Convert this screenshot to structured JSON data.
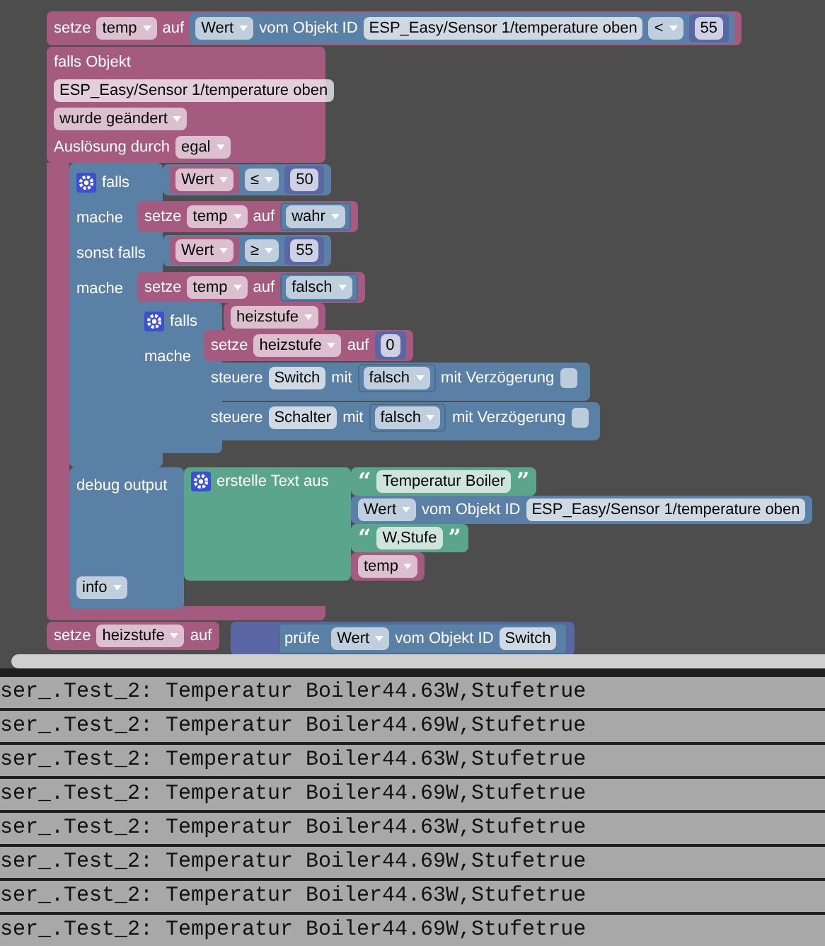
{
  "workspace": {
    "blocks": [
      {
        "kind": "variable",
        "lines": [
          [
            {
              "kind": "label",
              "text": "setze"
            },
            {
              "kind": "dropdown",
              "text": "temp"
            },
            {
              "kind": "label",
              "text": "auf"
            },
            {
              "kind": "sensor",
              "lines": [
                [
                  {
                    "kind": "dropdown",
                    "text": "Wert"
                  },
                  {
                    "kind": "label",
                    "text": "vom Objekt ID"
                  },
                  {
                    "kind": "field",
                    "text": "ESP_Easy/Sensor 1/temperature oben"
                  },
                  {
                    "kind": "dropdown",
                    "text": "<"
                  },
                  {
                    "kind": "math",
                    "lines": [
                      [
                        {
                          "kind": "number",
                          "text": "55"
                        }
                      ]
                    ]
                  }
                ]
              ]
            }
          ]
        ]
      },
      {
        "kind": "event",
        "lines": [
          [
            {
              "kind": "label",
              "text": "falls Objekt"
            }
          ],
          [
            {
              "kind": "field",
              "text": "ESP_Easy/Sensor 1/temperature oben"
            }
          ],
          [
            {
              "kind": "dropdown",
              "text": "wurde geändert"
            }
          ],
          [
            {
              "kind": "label",
              "text": "Auslösung durch"
            },
            {
              "kind": "dropdown",
              "text": "egal"
            }
          ]
        ]
      },
      {
        "kind": "control",
        "lines": [
          [
            {
              "kind": "gear"
            },
            {
              "kind": "label",
              "text": "falls"
            }
          ],
          [
            {
              "kind": "label",
              "text": "mache"
            }
          ],
          [
            {
              "kind": "label",
              "text": "sonst falls"
            }
          ],
          [
            {
              "kind": "label",
              "text": "mache"
            }
          ]
        ]
      },
      {
        "kind": "logic",
        "lines": [
          [
            {
              "kind": "variable",
              "lines": [
                [
                  {
                    "kind": "dropdown",
                    "text": "Wert"
                  }
                ]
              ]
            },
            {
              "kind": "dropdown",
              "text": "≤"
            },
            {
              "kind": "math",
              "lines": [
                [
                  {
                    "kind": "number",
                    "text": "50"
                  }
                ]
              ]
            }
          ]
        ]
      },
      {
        "kind": "variable",
        "lines": [
          [
            {
              "kind": "label",
              "text": "setze"
            },
            {
              "kind": "dropdown",
              "text": "temp"
            },
            {
              "kind": "label",
              "text": "auf"
            },
            {
              "kind": "logic",
              "lines": [
                [
                  {
                    "kind": "dropdown",
                    "text": "wahr"
                  }
                ]
              ]
            }
          ]
        ]
      },
      {
        "kind": "logic",
        "lines": [
          [
            {
              "kind": "variable",
              "lines": [
                [
                  {
                    "kind": "dropdown",
                    "text": "Wert"
                  }
                ]
              ]
            },
            {
              "kind": "dropdown",
              "text": "≥"
            },
            {
              "kind": "math",
              "lines": [
                [
                  {
                    "kind": "number",
                    "text": "55"
                  }
                ]
              ]
            }
          ]
        ]
      },
      {
        "kind": "variable",
        "lines": [
          [
            {
              "kind": "label",
              "text": "setze"
            },
            {
              "kind": "dropdown",
              "text": "temp"
            },
            {
              "kind": "label",
              "text": "auf"
            },
            {
              "kind": "logic",
              "lines": [
                [
                  {
                    "kind": "dropdown",
                    "text": "falsch"
                  }
                ]
              ]
            }
          ]
        ]
      },
      {
        "kind": "control",
        "lines": [
          [
            {
              "kind": "gear"
            },
            {
              "kind": "label",
              "text": "falls"
            }
          ],
          [
            {
              "kind": "label",
              "text": "mache"
            }
          ]
        ]
      },
      {
        "kind": "variable",
        "lines": [
          [
            {
              "kind": "dropdown",
              "text": "heizstufe"
            }
          ]
        ]
      },
      {
        "kind": "variable",
        "lines": [
          [
            {
              "kind": "label",
              "text": "setze"
            },
            {
              "kind": "dropdown",
              "text": "heizstufe"
            },
            {
              "kind": "label",
              "text": "auf"
            },
            {
              "kind": "math",
              "lines": [
                [
                  {
                    "kind": "number",
                    "text": "0"
                  }
                ]
              ]
            }
          ]
        ]
      },
      {
        "kind": "action",
        "lines": [
          [
            {
              "kind": "label",
              "text": "steuere"
            },
            {
              "kind": "field",
              "text": "Switch"
            },
            {
              "kind": "label",
              "text": "mit"
            },
            {
              "kind": "logic",
              "lines": [
                [
                  {
                    "kind": "dropdown",
                    "text": "falsch"
                  }
                ]
              ]
            },
            {
              "kind": "label",
              "text": "mit Verzögerung"
            },
            {
              "kind": "checkbox",
              "checked": false
            }
          ]
        ]
      },
      {
        "kind": "action",
        "lines": [
          [
            {
              "kind": "label",
              "text": "steuere"
            },
            {
              "kind": "field",
              "text": "Schalter"
            },
            {
              "kind": "label",
              "text": "mit"
            },
            {
              "kind": "logic",
              "lines": [
                [
                  {
                    "kind": "dropdown",
                    "text": "falsch"
                  }
                ]
              ]
            },
            {
              "kind": "label",
              "text": "mit Verzögerung"
            },
            {
              "kind": "checkbox",
              "checked": false
            }
          ]
        ]
      },
      {
        "kind": "debug",
        "lines": [
          [
            {
              "kind": "label",
              "text": "debug output"
            }
          ],
          [
            {
              "kind": "dropdown",
              "text": "info"
            }
          ]
        ]
      },
      {
        "kind": "text",
        "lines": [
          [
            {
              "kind": "gear"
            },
            {
              "kind": "label",
              "text": "erstelle Text aus"
            }
          ]
        ]
      },
      {
        "kind": "text",
        "lines": [
          [
            {
              "kind": "quote",
              "text": "“"
            },
            {
              "kind": "field",
              "text": "Temperatur Boiler"
            },
            {
              "kind": "quote",
              "text": "”"
            }
          ]
        ]
      },
      {
        "kind": "sensor",
        "lines": [
          [
            {
              "kind": "dropdown",
              "text": "Wert"
            },
            {
              "kind": "label",
              "text": "vom Objekt ID"
            },
            {
              "kind": "field",
              "text": "ESP_Easy/Sensor 1/temperature oben"
            }
          ]
        ]
      },
      {
        "kind": "text",
        "lines": [
          [
            {
              "kind": "quote",
              "text": "“"
            },
            {
              "kind": "field",
              "text": "W,Stufe"
            },
            {
              "kind": "quote",
              "text": "”"
            }
          ]
        ]
      },
      {
        "kind": "variable",
        "lines": [
          [
            {
              "kind": "dropdown",
              "text": "temp"
            }
          ]
        ]
      },
      {
        "kind": "variable",
        "lines": [
          [
            {
              "kind": "label",
              "text": "setze"
            },
            {
              "kind": "dropdown",
              "text": "heizstufe"
            },
            {
              "kind": "label",
              "text": "auf"
            }
          ]
        ]
      },
      {
        "kind": "ternary",
        "lines": [
          [
            {
              "kind": "logic",
              "lines": [
                [
                  {
                    "kind": "label",
                    "text": "prüfe"
                  },
                  {
                    "kind": "sensor",
                    "lines": [
                      [
                        {
                          "kind": "dropdown",
                          "text": "Wert"
                        },
                        {
                          "kind": "label",
                          "text": "vom Objekt ID"
                        },
                        {
                          "kind": "field",
                          "text": "Switch"
                        }
                      ]
                    ]
                  }
                ]
              ]
            }
          ]
        ]
      }
    ]
  },
  "log": {
    "lines": [
      "ser_.Test_2: Temperatur Boiler44.63W,Stufetrue",
      "ser_.Test_2: Temperatur Boiler44.69W,Stufetrue",
      "ser_.Test_2: Temperatur Boiler44.63W,Stufetrue",
      "ser_.Test_2: Temperatur Boiler44.69W,Stufetrue",
      "ser_.Test_2: Temperatur Boiler44.63W,Stufetrue",
      "ser_.Test_2: Temperatur Boiler44.69W,Stufetrue",
      "ser_.Test_2: Temperatur Boiler44.63W,Stufetrue",
      "ser_.Test_2: Temperatur Boiler44.69W,Stufetrue"
    ]
  }
}
